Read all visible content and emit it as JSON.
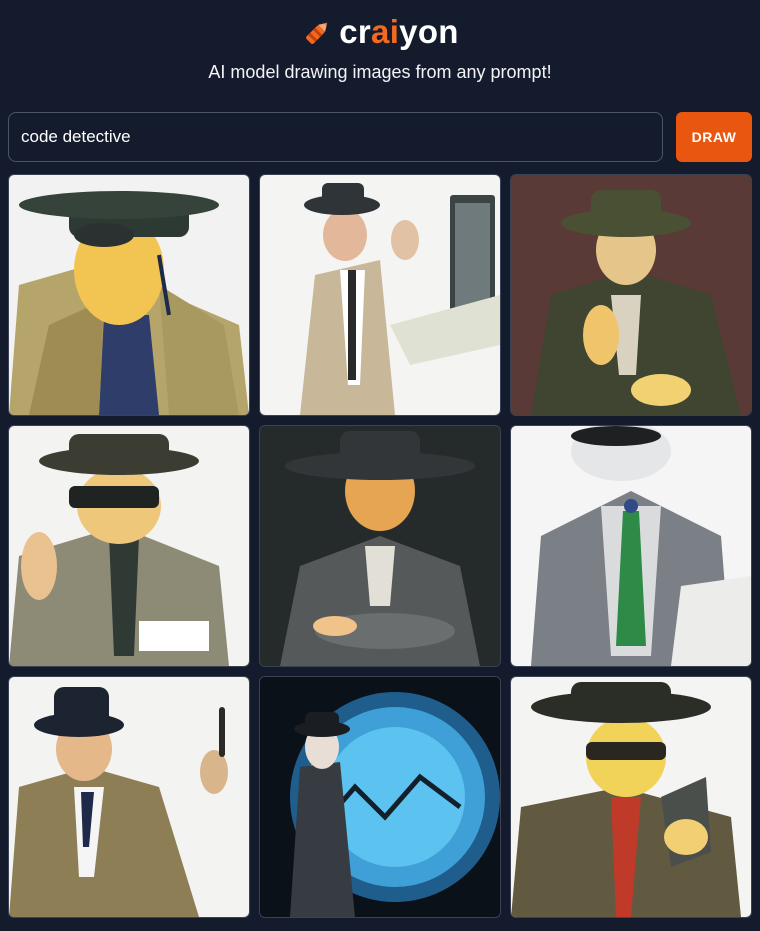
{
  "brand": {
    "name_prefix": "cr",
    "name_accent": "ai",
    "name_suffix": "yon",
    "icon": "crayon-icon",
    "accent_color": "#f26a21"
  },
  "tagline": "AI model drawing images from any prompt!",
  "search": {
    "value": "code detective",
    "button_label": "DRAW",
    "button_color": "#e8560f"
  },
  "results": [
    {
      "id": "image-1",
      "scene": "detective-in-trench-coat"
    },
    {
      "id": "image-2",
      "scene": "detective-at-computer"
    },
    {
      "id": "image-3",
      "scene": "detective-dark-green"
    },
    {
      "id": "image-4",
      "scene": "detective-thinking"
    },
    {
      "id": "image-5",
      "scene": "detective-arms-crossed"
    },
    {
      "id": "image-6",
      "scene": "detective-green-tie"
    },
    {
      "id": "image-7",
      "scene": "detective-holding-object"
    },
    {
      "id": "image-8",
      "scene": "detective-blue-portal"
    },
    {
      "id": "image-9",
      "scene": "detective-yellow-face"
    }
  ]
}
